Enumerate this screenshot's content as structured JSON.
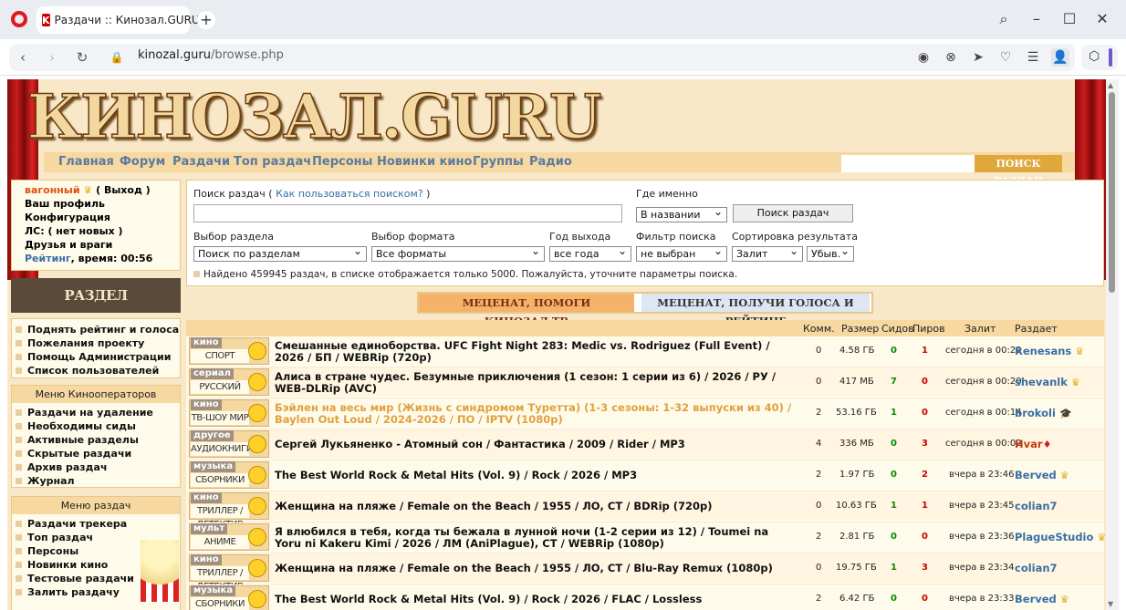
{
  "browser": {
    "tab_title": "Раздачи :: Кинозал.GURU",
    "tab_fav": "K",
    "new_tab": "+",
    "url_domain": "kinozal.guru",
    "url_path": "/browse.php"
  },
  "site": {
    "logo": "КИНОЗАЛ.GURU",
    "menu": [
      "Главная",
      "Форум",
      "Раздачи",
      "Топ раздач",
      "Персоны",
      "Новинки кино",
      "Группы",
      "Радио"
    ],
    "search_btn": "ПОИСК РАЗДАЧ"
  },
  "user": {
    "name": "вагонный",
    "logout": "( Выход )",
    "profile": "Ваш профиль",
    "config": "Конфигурация",
    "pm": "ЛС: ( нет новых )",
    "friends": "Друзья и враги",
    "rating_label": "Рейтинг",
    "time": ", время: 00:56"
  },
  "mecenat_title": "РАЗДЕЛ МЕЦЕНАТОВ",
  "box2": [
    "Поднять рейтинг и голоса",
    "Пожелания проекту",
    "Помощь Администрации",
    "Список пользователей"
  ],
  "box3": {
    "header": "Меню Кинооператоров",
    "items": [
      "Раздачи на удаление",
      "Необходимы сиды",
      "Активные разделы",
      "Скрытые раздачи",
      "Архив раздач",
      "Журнал"
    ]
  },
  "box4": {
    "header": "Меню раздач",
    "items": [
      "Раздачи трекера",
      "Топ раздач",
      "Персоны",
      "Новинки кино",
      "Тестовые раздачи",
      "Залить раздачу"
    ]
  },
  "search": {
    "label": "Поиск раздач",
    "howto_open": "( ",
    "howto": "Как пользоваться поиском?",
    "howto_close": " )",
    "where_label": "Где именно",
    "where_value": "В названии",
    "button": "Поиск раздач",
    "section_label": "Выбор раздела",
    "section_value": "Поиск по разделам",
    "format_label": "Выбор формата",
    "format_value": "Все форматы",
    "year_label": "Год выхода",
    "year_value": "все года",
    "filter_label": "Фильтр поиска",
    "filter_value": "не выбран",
    "sort_label": "Сортировка результата",
    "sort_value": "Залит",
    "order_value": "Убыв.",
    "found": "Найдено 459945 раздач, в списке отображается только 5000. Пожалуйста, уточните параметры поиска."
  },
  "banner": {
    "left": "МЕЦЕНАТ, ПОМОГИ КИНОЗАЛ.ТВ",
    "right": "МЕЦЕНАТ, ПОЛУЧИ ГОЛОСА И РЕЙТИНГ"
  },
  "table": {
    "headers": {
      "comments": "Комм.",
      "size": "Размер",
      "seeds": "Сидов",
      "peers": "Пиров",
      "added": "Залит",
      "uploader": "Раздает"
    },
    "rows": [
      {
        "type": "кино",
        "sub": "СПОРТ",
        "title": "Смешанные единоборства. UFC Fight Night 283: Medic vs. Rodriguez (Full Event) / 2026 / БП / WEBRip (720p)",
        "comm": "0",
        "size": "4.58 ГБ",
        "seeds": "0",
        "peers": "1",
        "date": "сегодня в 00:29",
        "uploader": "Renesans",
        "crown": "♛",
        "gold": false,
        "red": false
      },
      {
        "type": "сериал",
        "sub": "РУССКИЙ",
        "title": "Алиса в стране чудес. Безумные приключения (1 сезон: 1 серии из 6) / 2026 / РУ / WEB-DLRip (AVC)",
        "comm": "0",
        "size": "417 МБ",
        "seeds": "7",
        "peers": "0",
        "date": "сегодня в 00:20",
        "uploader": "shevanlk",
        "crown": "♛",
        "gold": false,
        "red": false
      },
      {
        "type": "кино",
        "sub": "ТВ-ШОУ МИР",
        "title": "Бэйлен на весь мир (Жизнь с синдромом Туретта) (1-3 сезоны: 1-32 выпуски из 40) / Baylen Out Loud / 2024-2026 / ПО / IPTV (1080p)",
        "comm": "2",
        "size": "53.16 ГБ",
        "seeds": "1",
        "peers": "0",
        "date": "сегодня в 00:14",
        "uploader": "brokoli",
        "crown": "🎓",
        "gold": true,
        "red": false
      },
      {
        "type": "другое",
        "sub": "АУДИОКНИГИ",
        "title": "Сергей Лукьяненко - Атомный сон / Фантастика / 2009 / Rider / MP3",
        "comm": "4",
        "size": "336 МБ",
        "seeds": "0",
        "peers": "3",
        "date": "сегодня в 00:02",
        "uploader": "Hvar",
        "crown": "♦",
        "gold": false,
        "red": true
      },
      {
        "type": "музыка",
        "sub": "СБОРНИКИ",
        "title": "The Best World Rock & Metal Hits (Vol. 9) / Rock / 2026 / MP3",
        "comm": "2",
        "size": "1.97 ГБ",
        "seeds": "0",
        "peers": "2",
        "date": "вчера в 23:46",
        "uploader": "Berved",
        "crown": "♛",
        "gold": false,
        "red": false
      },
      {
        "type": "кино",
        "sub": "ТРИЛЛЕР / ДЕТЕКТИВ",
        "title": "Женщина на пляже / Female on the Beach / 1955 / ЛО, СТ / BDRip (720p)",
        "comm": "0",
        "size": "10.63 ГБ",
        "seeds": "1",
        "peers": "1",
        "date": "вчера в 23:45",
        "uploader": "colian7",
        "crown": "",
        "gold": false,
        "red": false
      },
      {
        "type": "мульт",
        "sub": "АНИМЕ",
        "title": "Я влюбился в тебя, когда ты бежала в лунной ночи (1-2 серии из 12) / Toumei na Yoru ni Kakeru Kimi / 2026 / ЛМ (AniPlague), СТ / WEBRip (1080p)",
        "comm": "2",
        "size": "2.81 ГБ",
        "seeds": "0",
        "peers": "0",
        "date": "вчера в 23:36",
        "uploader": "PlagueStudio",
        "crown": "♛",
        "gold": false,
        "red": false
      },
      {
        "type": "кино",
        "sub": "ТРИЛЛЕР / ДЕТЕКТИВ",
        "title": "Женщина на пляже / Female on the Beach / 1955 / ЛО, СТ / Blu-Ray Remux (1080p)",
        "comm": "0",
        "size": "19.75 ГБ",
        "seeds": "1",
        "peers": "3",
        "date": "вчера в 23:34",
        "uploader": "colian7",
        "crown": "",
        "gold": false,
        "red": false
      },
      {
        "type": "музыка",
        "sub": "СБОРНИКИ",
        "title": "The Best World Rock & Metal Hits (Vol. 9) / Rock / 2026 / FLAC / Lossless",
        "comm": "2",
        "size": "6.42 ГБ",
        "seeds": "0",
        "peers": "0",
        "date": "вчера в 23:33",
        "uploader": "Berved",
        "crown": "♛",
        "gold": false,
        "red": false
      }
    ]
  }
}
